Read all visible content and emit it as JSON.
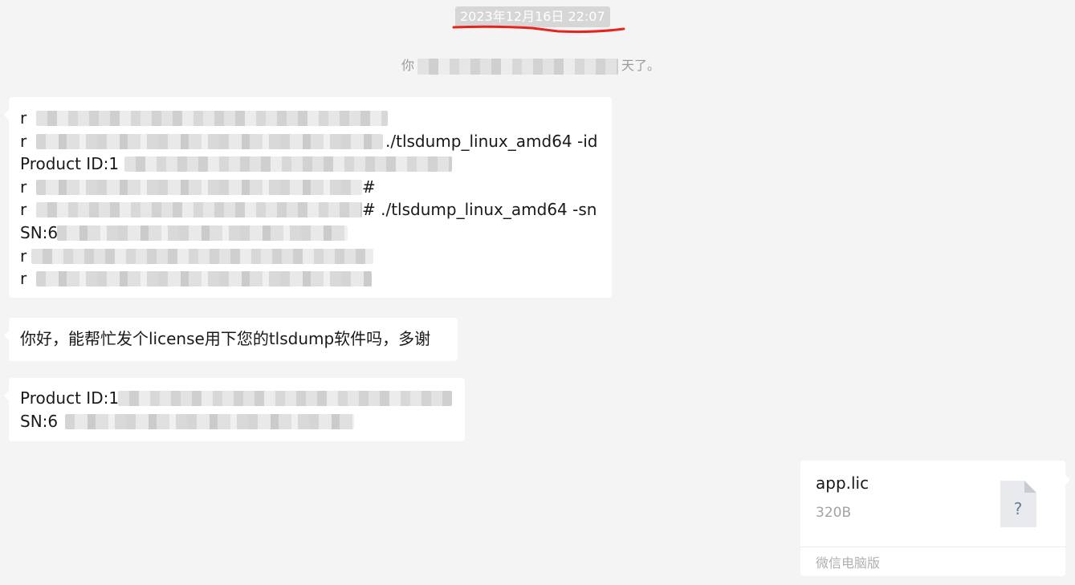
{
  "timestamp": "2023年12月16日 22:07",
  "system_notice": {
    "start": "你",
    "end": "天了。"
  },
  "messages": {
    "terminal": {
      "lines": [
        {
          "prefix": "r",
          "cmd": ""
        },
        {
          "prefix": "r",
          "cmd": "./tlsdump_linux_amd64  -id"
        },
        {
          "prefix": "Product ID:1",
          "cmd": ""
        },
        {
          "prefix": "r",
          "cmd": "#"
        },
        {
          "prefix": "r",
          "cmd": "# ./tlsdump_linux_amd64  -sn"
        },
        {
          "prefix": "SN:6",
          "cmd": ""
        },
        {
          "prefix": "r",
          "cmd": ""
        },
        {
          "prefix": "r",
          "cmd": ""
        }
      ]
    },
    "request": "你好，能帮忙发个license用下您的tlsdump软件吗，多谢",
    "ids": {
      "product_id": "Product ID:1",
      "sn": "SN:6"
    }
  },
  "file": {
    "name": "app.lic",
    "size": "320B",
    "icon_glyph": "?",
    "source": "微信电脑版"
  },
  "colors": {
    "underline": "#e8231b",
    "bubble": "#ffffff",
    "background": "#f4f4f4"
  }
}
